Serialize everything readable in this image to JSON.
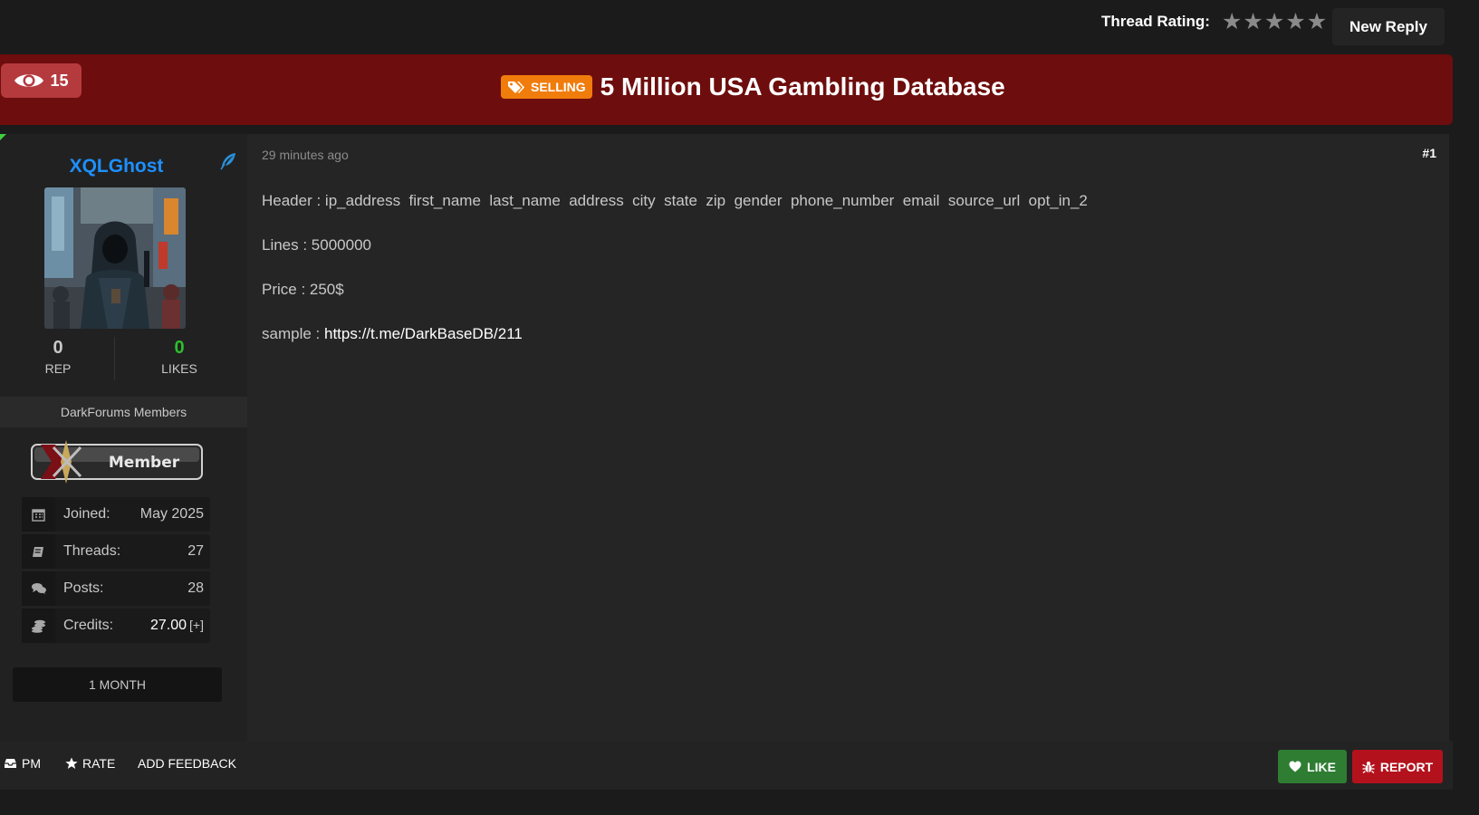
{
  "header": {
    "rating_label": "Thread Rating:",
    "stars": [
      "★",
      "★",
      "★",
      "★",
      "★"
    ],
    "new_reply_label": "New Reply"
  },
  "thread": {
    "views": "15",
    "prefix": "SELLING",
    "title": "5 Million USA Gambling Database"
  },
  "author": {
    "username": "XQLGhost",
    "rep_value": "0",
    "rep_label": "REP",
    "likes_value": "0",
    "likes_label": "LIKES",
    "group": "DarkForums Members",
    "rank_label": "Member",
    "joined_label": "Joined:",
    "joined_value": "May 2025",
    "threads_label": "Threads:",
    "threads_value": "27",
    "posts_label": "Posts:",
    "posts_value": "28",
    "credits_label": "Credits:",
    "credits_value": "27.00",
    "credits_plus": "[+]",
    "membership": "1 MONTH"
  },
  "post": {
    "time": "29 minutes ago",
    "number": "#1",
    "header_line": "Header : ip_address  first_name  last_name  address  city  state  zip  gender  phone_number  email  source_url  opt_in_2",
    "lines_line": "Lines : 5000000",
    "price_line": "Price : 250$",
    "sample_prefix": "sample : ",
    "sample_link": "https://t.me/DarkBaseDB/211"
  },
  "actions": {
    "pm": "PM",
    "rate": "RATE",
    "feedback": "ADD FEEDBACK",
    "like": "LIKE",
    "report": "REPORT"
  },
  "colors": {
    "title_bar": "#6e0d0d",
    "prefix": "#f07c0c",
    "username": "#1e90ff",
    "likes": "#2ebd2e",
    "like_button": "#2e7d32",
    "report_button": "#b3121d"
  }
}
